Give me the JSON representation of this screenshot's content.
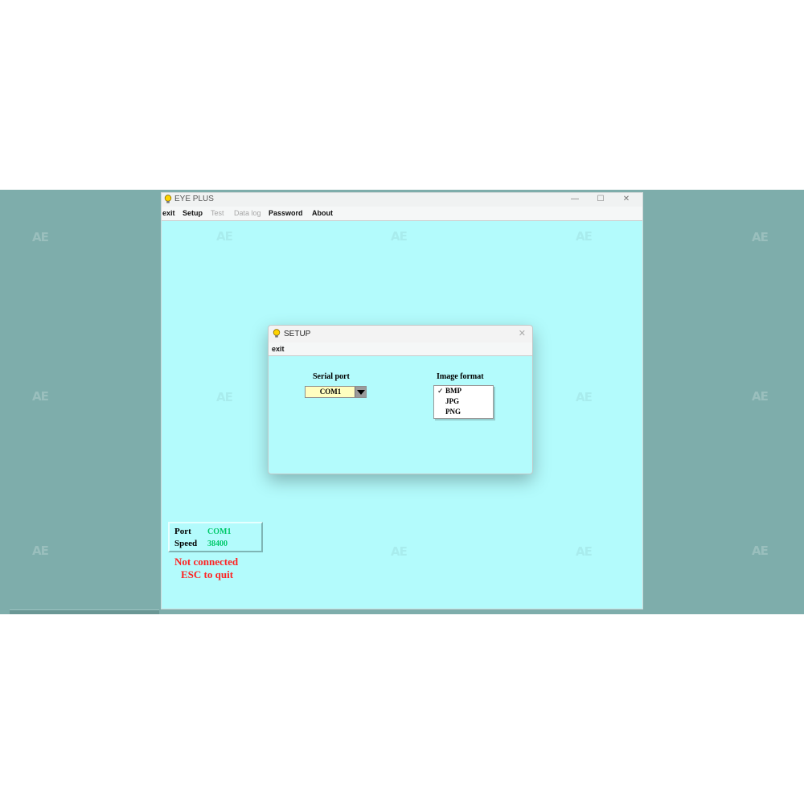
{
  "main_window": {
    "title": "EYE PLUS",
    "menu": {
      "exit": "exit",
      "setup": "Setup",
      "test": "Test",
      "data_log": "Data log",
      "password": "Password",
      "about": "About"
    },
    "controls": {
      "minimize": "—",
      "maximize": "☐",
      "close": "✕"
    }
  },
  "status": {
    "port_label": "Port",
    "port_value": "COM1",
    "speed_label": "Speed",
    "speed_value": "38400",
    "connection": "Not connected",
    "quit_hint": "ESC to quit"
  },
  "setup_dialog": {
    "title": "SETUP",
    "close": "✕",
    "menu_exit": "exit",
    "serial_port_label": "Serial port",
    "serial_port_value": "COM1",
    "image_format_label": "Image format",
    "image_format_options": [
      "BMP",
      "JPG",
      "PNG"
    ],
    "image_format_selected": "BMP",
    "check_mark": "✓"
  },
  "watermark": "AE",
  "colors": {
    "desktop": "#7eadab",
    "window_bg": "#b3fbfc",
    "status_ok": "#00c96a",
    "status_error": "#ff2222",
    "combo_bg": "#fffec0"
  },
  "icons": {
    "app": "lightbulb-icon",
    "dropdown": "dropdown-arrow-icon"
  }
}
